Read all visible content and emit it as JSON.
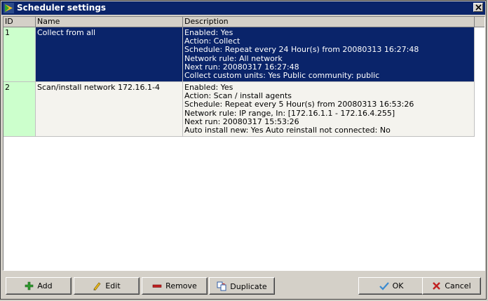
{
  "window": {
    "title": "Scheduler settings"
  },
  "grid": {
    "columns": {
      "id": "ID",
      "name": "Name",
      "description": "Description"
    },
    "rows": [
      {
        "id": "1",
        "name": "Collect from all",
        "description": [
          "Enabled: Yes",
          "Action: Collect",
          "Schedule: Repeat every 24 Hour(s) from 20080313 16:27:48",
          "Network rule: All network",
          "Next run: 20080317 16:27:48",
          "Collect custom units: Yes Public community: public"
        ]
      },
      {
        "id": "2",
        "name": "Scan/install network 172.16.1-4",
        "description": [
          "Enabled: Yes",
          "Action: Scan / install agents",
          "Schedule: Repeat every 5 Hour(s) from 20080313 16:53:26",
          "Network rule: IP range, In: [172.16.1.1 - 172.16.4.255]",
          "Next run: 20080317 15:53:26",
          "Auto install new: Yes Auto reinstall not connected: No"
        ]
      }
    ]
  },
  "buttons": {
    "add": "Add",
    "edit": "Edit",
    "remove": "Remove",
    "duplicate": "Duplicate",
    "ok": "OK",
    "cancel": "Cancel"
  },
  "colors": {
    "titlebar": "#0a246a",
    "selection": "#0a246a",
    "id_column": "#ccffcc",
    "row_background": "#f4f3ee",
    "dialog_face": "#d4d0c8"
  }
}
